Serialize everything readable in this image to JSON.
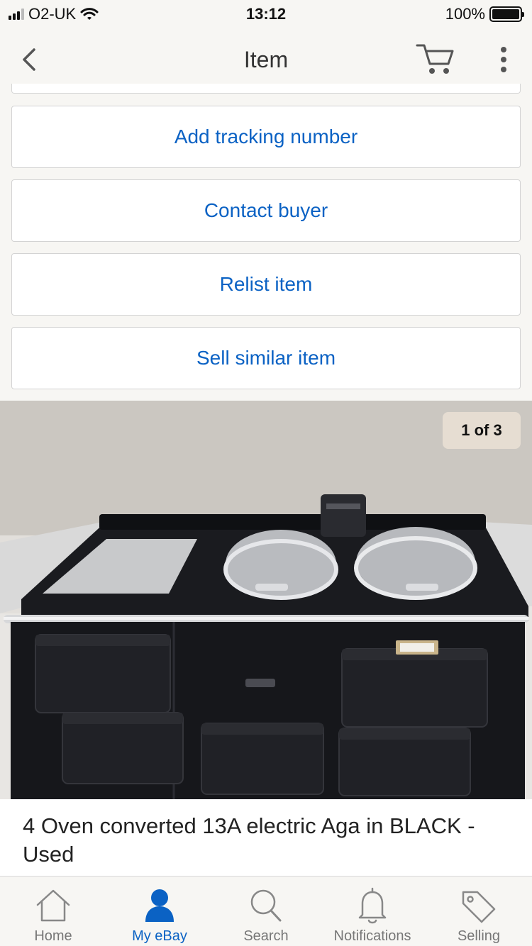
{
  "status_bar": {
    "carrier": "O2-UK",
    "time": "13:12",
    "battery": "100%"
  },
  "nav": {
    "title": "Item"
  },
  "actions": [
    {
      "label": "Add tracking number"
    },
    {
      "label": "Contact buyer"
    },
    {
      "label": "Relist item"
    },
    {
      "label": "Sell similar item"
    }
  ],
  "gallery": {
    "counter": "1 of 3"
  },
  "item": {
    "title": "4 Oven converted 13A electric Aga in BLACK - Used"
  },
  "tabs": [
    {
      "label": "Home",
      "icon": "home-icon",
      "active": false
    },
    {
      "label": "My eBay",
      "icon": "person-icon",
      "active": true
    },
    {
      "label": "Search",
      "icon": "search-icon",
      "active": false
    },
    {
      "label": "Notifications",
      "icon": "bell-icon",
      "active": false
    },
    {
      "label": "Selling",
      "icon": "tag-icon",
      "active": false
    }
  ],
  "colors": {
    "accent": "#0b62c4",
    "background": "#f7f6f3",
    "tab_inactive": "#777777"
  }
}
